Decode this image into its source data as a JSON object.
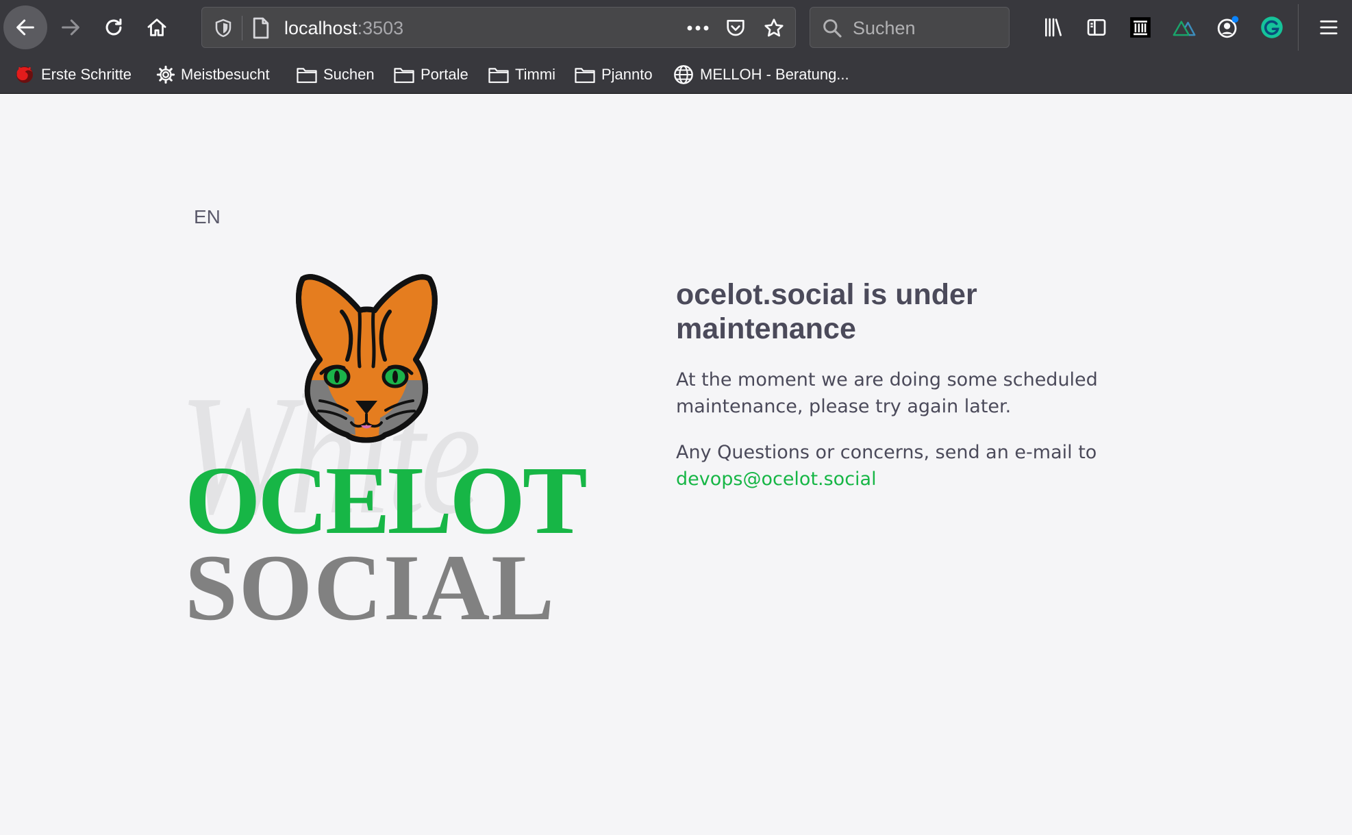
{
  "browser": {
    "url_host": "localhost",
    "url_port": ":3503",
    "search_placeholder": "Suchen",
    "bookmarks": [
      {
        "label": "Erste Schritte",
        "icon": "firefox-icon"
      },
      {
        "label": "Meistbesucht",
        "icon": "gear-icon"
      },
      {
        "label": "Suchen",
        "icon": "folder-icon"
      },
      {
        "label": "Portale",
        "icon": "folder-icon"
      },
      {
        "label": "Timmi",
        "icon": "folder-icon"
      },
      {
        "label": "Pjannto",
        "icon": "folder-icon"
      },
      {
        "label": "MELLOH - Beratung...",
        "icon": "globe-icon"
      }
    ]
  },
  "page": {
    "language": "EN",
    "logo": {
      "watermark": "White",
      "line1": "OCELOT",
      "line2": "SOCIAL"
    },
    "title": "ocelot.social is under maintenance",
    "message": "At the moment we are doing some scheduled maintenance, please try again later.",
    "contact_text": "Any Questions or concerns, send an e-mail to",
    "contact_email": "devops@ocelot.social"
  },
  "colors": {
    "brand_green": "#17b646",
    "logo_gray": "#818181",
    "text": "#4b4a5a",
    "chrome_bg": "#38383d"
  }
}
